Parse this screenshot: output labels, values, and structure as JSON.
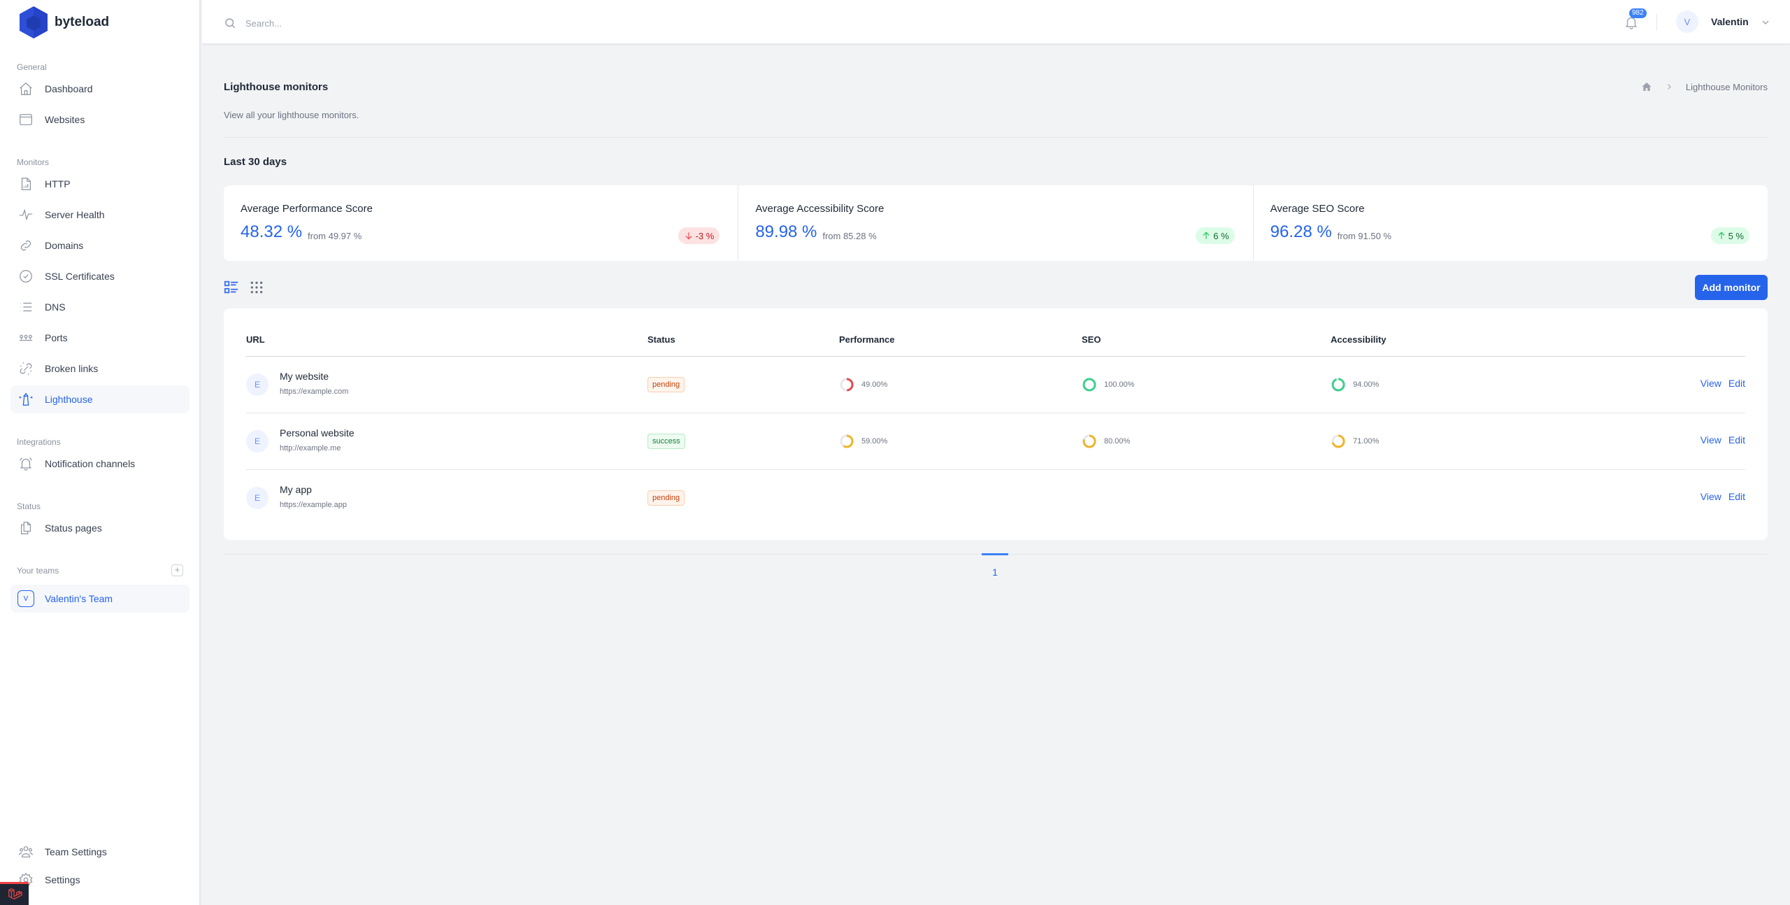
{
  "brand": {
    "name": "byteload"
  },
  "sidebar": {
    "sections": [
      {
        "label": "General",
        "items": [
          {
            "label": "Dashboard",
            "icon": "home-icon"
          },
          {
            "label": "Websites",
            "icon": "browser-window-icon"
          }
        ]
      },
      {
        "label": "Monitors",
        "items": [
          {
            "label": "HTTP",
            "icon": "document-chart-icon"
          },
          {
            "label": "Server Health",
            "icon": "pulse-icon"
          },
          {
            "label": "Domains",
            "icon": "link-icon"
          },
          {
            "label": "SSL Certificates",
            "icon": "badge-check-icon"
          },
          {
            "label": "DNS",
            "icon": "list-icon"
          },
          {
            "label": "Ports",
            "icon": "ports-icon"
          },
          {
            "label": "Broken links",
            "icon": "broken-link-icon"
          },
          {
            "label": "Lighthouse",
            "icon": "lighthouse-icon",
            "active": true
          }
        ]
      },
      {
        "label": "Integrations",
        "items": [
          {
            "label": "Notification channels",
            "icon": "bell-ringing-icon"
          }
        ]
      },
      {
        "label": "Status",
        "items": [
          {
            "label": "Status pages",
            "icon": "documents-icon"
          }
        ]
      }
    ],
    "teams": {
      "label": "Your teams",
      "add_label": "+",
      "items": [
        {
          "initial": "V",
          "name": "Valentin's Team",
          "active": true
        }
      ]
    },
    "bottom": [
      {
        "label": "Team Settings",
        "icon": "users-icon"
      },
      {
        "label": "Settings",
        "icon": "gear-icon"
      }
    ]
  },
  "header": {
    "search_placeholder": "Search...",
    "notifications_count": "982",
    "user": {
      "initial": "V",
      "name": "Valentin"
    }
  },
  "page": {
    "title": "Lighthouse monitors",
    "subtitle": "View all your lighthouse monitors.",
    "breadcrumb": [
      "Home",
      "Lighthouse Monitors"
    ],
    "period_title": "Last 30 days"
  },
  "stats": [
    {
      "label": "Average Performance Score",
      "value": "48.32 %",
      "from": "from 49.97 %",
      "change": "-3 %",
      "direction": "down"
    },
    {
      "label": "Average Accessibility Score",
      "value": "89.98 %",
      "from": "from 85.28 %",
      "change": "6 %",
      "direction": "up"
    },
    {
      "label": "Average SEO Score",
      "value": "96.28 %",
      "from": "from 91.50 %",
      "change": "5 %",
      "direction": "up"
    }
  ],
  "toolbar": {
    "add_label": "Add monitor",
    "view_mode": "list"
  },
  "table": {
    "columns": [
      "URL",
      "Status",
      "Performance",
      "SEO",
      "Accessibility"
    ],
    "rows": [
      {
        "initial": "E",
        "name": "My website",
        "url": "https://example.com",
        "status": "pending",
        "performance": {
          "value": 49,
          "label": "49.00%"
        },
        "seo": {
          "value": 100,
          "label": "100.00%"
        },
        "accessibility": {
          "value": 94,
          "label": "94.00%"
        },
        "view_label": "View",
        "edit_label": "Edit"
      },
      {
        "initial": "E",
        "name": "Personal website",
        "url": "http://example.me",
        "status": "success",
        "performance": {
          "value": 59,
          "label": "59.00%"
        },
        "seo": {
          "value": 80,
          "label": "80.00%"
        },
        "accessibility": {
          "value": 71,
          "label": "71.00%"
        },
        "view_label": "View",
        "edit_label": "Edit"
      },
      {
        "initial": "E",
        "name": "My app",
        "url": "https://example.app",
        "status": "pending",
        "performance": null,
        "seo": null,
        "accessibility": null,
        "view_label": "View",
        "edit_label": "Edit"
      }
    ]
  },
  "pagination": {
    "current": "1"
  },
  "colors": {
    "accent": "#2563eb",
    "score_low": "#e5484d",
    "score_mid": "#f0b429",
    "score_high": "#3ecf8e",
    "track": "#e8e8ec"
  }
}
